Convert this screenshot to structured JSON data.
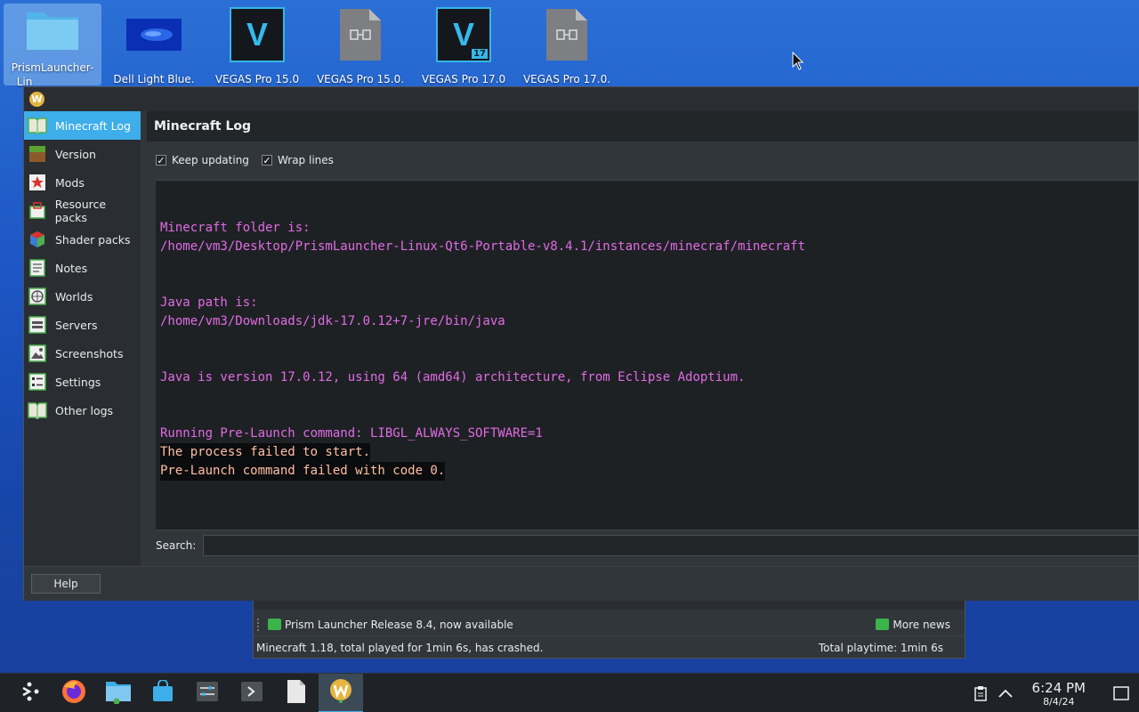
{
  "desktop": {
    "icons": [
      {
        "label": "PrismLauncher-",
        "label2": "Lin",
        "icon": "folder-icon"
      },
      {
        "label": "Dell Light Blue.",
        "icon": "image-file-icon"
      },
      {
        "label": "VEGAS Pro 15.0",
        "icon": "vegas-pro-icon",
        "glyph": "V"
      },
      {
        "label": "VEGAS Pro 15.0.",
        "icon": "binary-file-icon"
      },
      {
        "label": "VEGAS Pro 17.0",
        "icon": "vegas-pro-icon",
        "glyph": "V",
        "badge": "17"
      },
      {
        "label": "VEGAS Pro 17.0.",
        "icon": "binary-file-icon"
      }
    ]
  },
  "window": {
    "app_icon_glyph": "W",
    "sidebar": [
      {
        "label": "Minecraft Log",
        "icon": "log-book-icon",
        "active": true
      },
      {
        "label": "Version",
        "icon": "grass-block-icon"
      },
      {
        "label": "Mods",
        "icon": "star-icon"
      },
      {
        "label": "Resource packs",
        "icon": "package-icon"
      },
      {
        "label": "Shader packs",
        "icon": "cube-icon"
      },
      {
        "label": "Notes",
        "icon": "notes-icon"
      },
      {
        "label": "Worlds",
        "icon": "world-icon"
      },
      {
        "label": "Servers",
        "icon": "server-icon"
      },
      {
        "label": "Screenshots",
        "icon": "screenshot-icon"
      },
      {
        "label": "Settings",
        "icon": "settings-icon"
      },
      {
        "label": "Other logs",
        "icon": "log-book-icon"
      }
    ],
    "page_title": "Minecraft Log",
    "keep_updating": {
      "label": "Keep updating",
      "checked": "✓"
    },
    "wrap_lines": {
      "label": "Wrap lines",
      "checked": "✓"
    },
    "log_lines": [
      {
        "text": "",
        "style": "p"
      },
      {
        "text": "Minecraft folder is:",
        "style": "p"
      },
      {
        "text": "/home/vm3/Desktop/PrismLauncher-Linux-Qt6-Portable-v8.4.1/instances/minecraf/minecraft",
        "style": "p"
      },
      {
        "text": "",
        "style": "p"
      },
      {
        "text": "",
        "style": "p"
      },
      {
        "text": "Java path is:",
        "style": "p"
      },
      {
        "text": "/home/vm3/Downloads/jdk-17.0.12+7-jre/bin/java",
        "style": "p"
      },
      {
        "text": "",
        "style": "p"
      },
      {
        "text": "",
        "style": "p"
      },
      {
        "text": "Java is version 17.0.12, using 64 (amd64) architecture, from Eclipse Adoptium.",
        "style": "p"
      },
      {
        "text": "",
        "style": "p"
      },
      {
        "text": "",
        "style": "p"
      },
      {
        "text": "Running Pre-Launch command: LIBGL_ALWAYS_SOFTWARE=1",
        "style": "p"
      },
      {
        "text": "The process failed to start.",
        "style": "err"
      },
      {
        "text": "Pre-Launch command failed with code 0.",
        "style": "err"
      }
    ],
    "search_label": "Search:",
    "search_value": "",
    "help_label": "Help"
  },
  "launcher": {
    "news": "Prism Launcher Release 8.4, now available",
    "more_news": "More news",
    "status": "Minecraft 1.18, total played for 1min 6s, has crashed.",
    "total_playtime": "Total playtime: 1min 6s"
  },
  "taskbar": {
    "buttons": [
      {
        "name": "app-launcher-icon"
      },
      {
        "name": "firefox-icon"
      },
      {
        "name": "file-manager-icon"
      },
      {
        "name": "discover-store-icon"
      },
      {
        "name": "system-settings-icon"
      },
      {
        "name": "terminal-icon"
      },
      {
        "name": "text-file-icon"
      },
      {
        "name": "prism-launcher-icon",
        "active": true
      }
    ],
    "clock_time": "6:24 PM",
    "clock_date": "8/4/24"
  }
}
